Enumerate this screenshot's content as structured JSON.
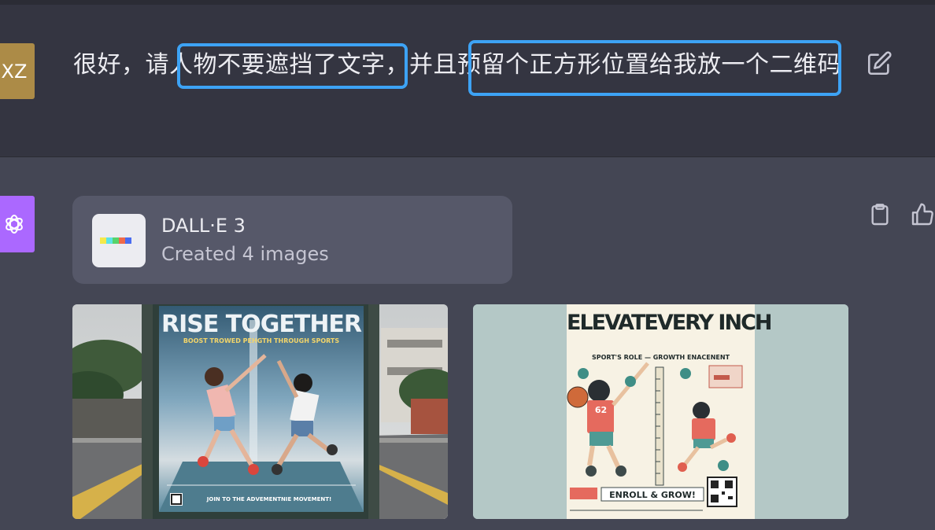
{
  "user_message": {
    "avatar_initials": "XZ",
    "text": "很好，请人物不要遮挡了文字，并且预留个正方形位置给我放一个二维码"
  },
  "assistant": {
    "tool_name": "DALL·E 3",
    "tool_status": "Created 4 images"
  },
  "images": [
    {
      "title": "RISE TOGETHER",
      "subtitle": "BOOST TROWED PEHGTH THROUGH SPORTS",
      "footer": "JOIN TO THE ADVEMENTNIE MOVEMENT!"
    },
    {
      "title": "ELEVATEVERY INCH",
      "subtitle": "SPORT'S ROLE — GROWTH ENACENENT",
      "badge": "ENROLL & GROW!",
      "jersey": "62"
    }
  ],
  "icons": {
    "edit": "edit-icon",
    "copy": "clipboard-icon",
    "like": "thumbs-up-icon",
    "assistant_avatar": "openai-logo-icon"
  },
  "colors": {
    "highlight": "#3da3f5",
    "user_avatar_bg": "#ac8b47",
    "assistant_avatar_bg": "#ab68ff"
  }
}
